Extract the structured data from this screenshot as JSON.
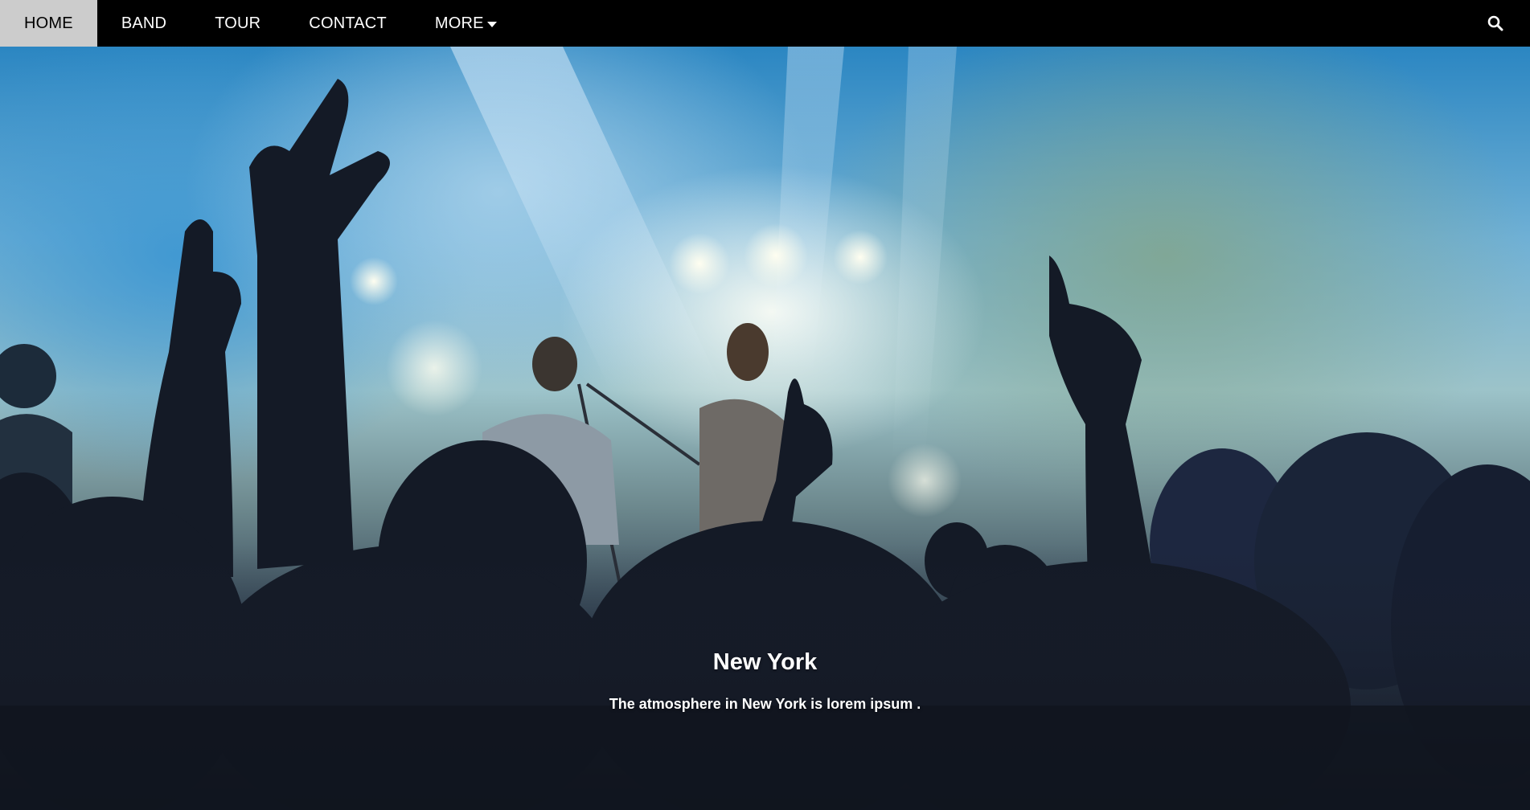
{
  "nav": {
    "items": [
      {
        "label": "HOME"
      },
      {
        "label": "BAND"
      },
      {
        "label": "TOUR"
      },
      {
        "label": "CONTACT"
      },
      {
        "label": "MORE",
        "icon": "caret-down-icon"
      }
    ],
    "search_icon": "search-icon"
  },
  "hero": {
    "image": "concert-crowd-photo",
    "title": "New York",
    "text": "The atmosphere in New York is lorem ipsum ."
  },
  "colors": {
    "navbar_bg": "#000000",
    "nav_text": "#ffffff",
    "caption_text": "#ffffff"
  }
}
